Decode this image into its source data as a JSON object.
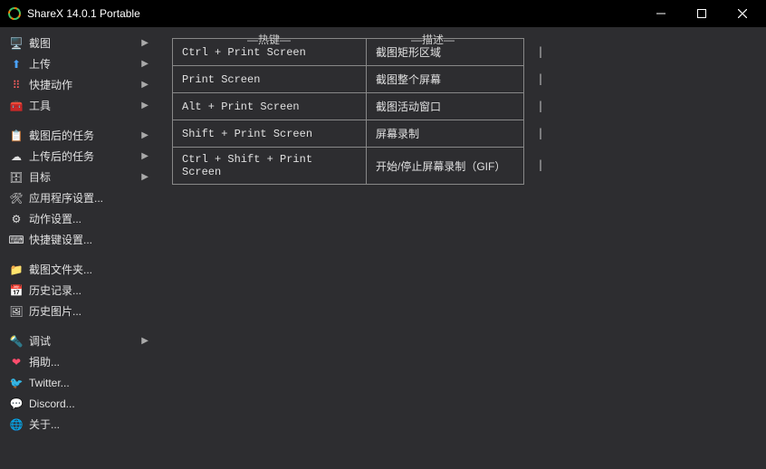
{
  "window": {
    "title": "ShareX 14.0.1 Portable"
  },
  "sidebar": {
    "groups": [
      [
        {
          "icon": "🖥️",
          "icon_name": "screenshot-icon",
          "label": "截图",
          "sub": true
        },
        {
          "icon": "⬆",
          "icon_name": "upload-icon",
          "color": "#4aa3ff",
          "label": "上传",
          "sub": true
        },
        {
          "icon": "⠿",
          "icon_name": "quick-actions-icon",
          "color": "#ff6060",
          "label": "快捷动作",
          "sub": true
        },
        {
          "icon": "🧰",
          "icon_name": "tools-icon",
          "label": "工具",
          "sub": true
        }
      ],
      [
        {
          "icon": "📋",
          "icon_name": "after-capture-icon",
          "label": "截图后的任务",
          "sub": true
        },
        {
          "icon": "☁",
          "icon_name": "after-upload-icon",
          "label": "上传后的任务",
          "sub": true
        },
        {
          "icon": "🗄",
          "icon_name": "destinations-icon",
          "label": "目标",
          "sub": true
        },
        {
          "icon": "🛠",
          "icon_name": "app-settings-icon",
          "label": "应用程序设置...",
          "sub": false
        },
        {
          "icon": "⚙",
          "icon_name": "task-settings-icon",
          "label": "动作设置...",
          "sub": false
        },
        {
          "icon": "⌨",
          "icon_name": "hotkey-settings-icon",
          "label": "快捷键设置...",
          "sub": false
        }
      ],
      [
        {
          "icon": "📁",
          "icon_name": "folder-icon",
          "label": "截图文件夹...",
          "sub": false
        },
        {
          "icon": "📅",
          "icon_name": "history-icon",
          "label": "历史记录...",
          "sub": false
        },
        {
          "icon": "🖼",
          "icon_name": "image-history-icon",
          "label": "历史图片...",
          "sub": false
        }
      ],
      [
        {
          "icon": "🔦",
          "icon_name": "debug-icon",
          "label": "调试",
          "sub": true
        },
        {
          "icon": "❤",
          "icon_name": "donate-icon",
          "color": "#ff4d6d",
          "label": "捐助...",
          "sub": false
        },
        {
          "icon": "🐦",
          "icon_name": "twitter-icon",
          "color": "#4aa3ff",
          "label": "Twitter...",
          "sub": false
        },
        {
          "icon": "💬",
          "icon_name": "discord-icon",
          "color": "#6a7dff",
          "label": "Discord...",
          "sub": false
        },
        {
          "icon": "🌐",
          "icon_name": "about-icon",
          "label": "关于...",
          "sub": false
        }
      ]
    ]
  },
  "hotkeys": {
    "header_key": "热键",
    "header_desc": "描述",
    "rows": [
      {
        "key": "Ctrl + Print Screen",
        "desc": "截图矩形区域"
      },
      {
        "key": "Print Screen",
        "desc": "截图整个屏幕"
      },
      {
        "key": "Alt + Print Screen",
        "desc": "截图活动窗口"
      },
      {
        "key": "Shift + Print Screen",
        "desc": "屏幕录制"
      },
      {
        "key": "Ctrl + Shift + Print Screen",
        "desc": "开始/停止屏幕录制（GIF）"
      }
    ]
  }
}
